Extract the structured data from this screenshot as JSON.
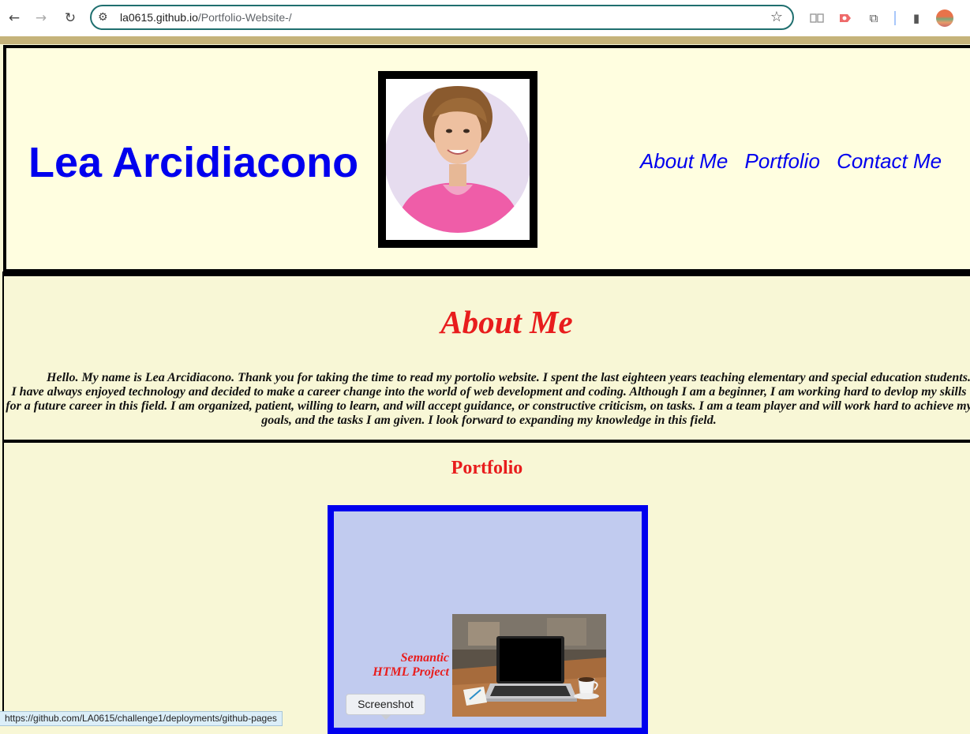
{
  "browser": {
    "url_host": "la0615.github.io",
    "url_path": "/Portfolio-Website-/",
    "back_icon": "←",
    "forward_icon": "→",
    "reload_icon": "↻",
    "site_settings_icon": "⚙",
    "bookmark_icon": "☆",
    "extensions_icon": "⧉",
    "side_panel_icon": "▮"
  },
  "header": {
    "name": "Lea Arcidiacono",
    "nav": [
      "About Me",
      "Portfolio",
      "Contact Me"
    ]
  },
  "about": {
    "title": "About Me",
    "text": "Hello. My name is Lea Arcidiacono. Thank you for taking the time to read my portolio website. I spent the last eighteen years teaching elementary and special education students. I have always enjoyed technology and decided to make a career change into the world of web development and coding. Although I am a beginner, I am working hard to devlop my skills for a future career in this field. I am organized, patient, willing to learn, and will accept guidance, or constructive criticism, on tasks. I am a team player and will work hard to achieve my goals, and the tasks I am given. I look forward to expanding my knowledge in this field."
  },
  "portfolio": {
    "title": "Portfolio",
    "project_label_line1": "Semantic",
    "project_label_line2": "HTML Project"
  },
  "tooltip": "Screenshot",
  "status_url": "https://github.com/LA0615/challenge1/deployments/github-pages",
  "colors": {
    "link_blue": "#0000ee",
    "heading_red": "#e81d1d",
    "header_bg": "#fffee0",
    "page_bg": "#f8f7d6",
    "card_bg": "#c1cbef"
  }
}
